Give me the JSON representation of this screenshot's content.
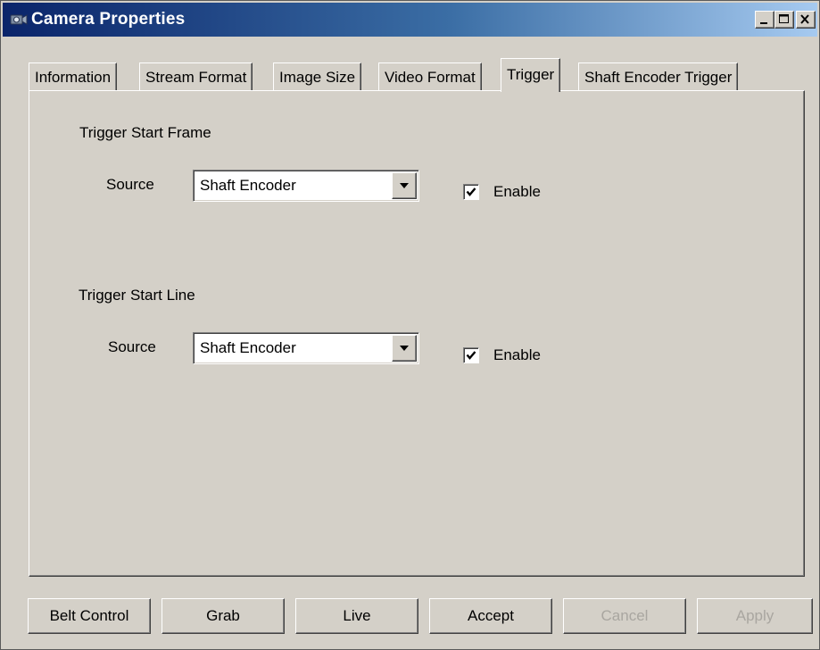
{
  "window": {
    "title": "Camera Properties",
    "icon": "camera-icon"
  },
  "tabs": [
    {
      "label": "Information",
      "active": false
    },
    {
      "label": "Stream Format",
      "active": false
    },
    {
      "label": "Image Size",
      "active": false
    },
    {
      "label": "Video Format",
      "active": false
    },
    {
      "label": "Trigger",
      "active": true
    },
    {
      "label": "Shaft Encoder Trigger",
      "active": false
    }
  ],
  "trigger_start_frame": {
    "group_label": "Trigger Start Frame",
    "source_label": "Source",
    "source_value": "Shaft Encoder",
    "enable_label": "Enable",
    "enabled": true
  },
  "trigger_start_line": {
    "group_label": "Trigger Start Line",
    "source_label": "Source",
    "source_value": "Shaft Encoder",
    "enable_label": "Enable",
    "enabled": true
  },
  "buttons": {
    "belt_control": "Belt Control",
    "grab": "Grab",
    "live": "Live",
    "accept": "Accept",
    "cancel": "Cancel",
    "apply": "Apply"
  },
  "colors": {
    "face": "#d4d0c8",
    "title_start": "#0a246a",
    "title_end": "#a6caf0",
    "disabled_text": "#a9a6a0"
  }
}
